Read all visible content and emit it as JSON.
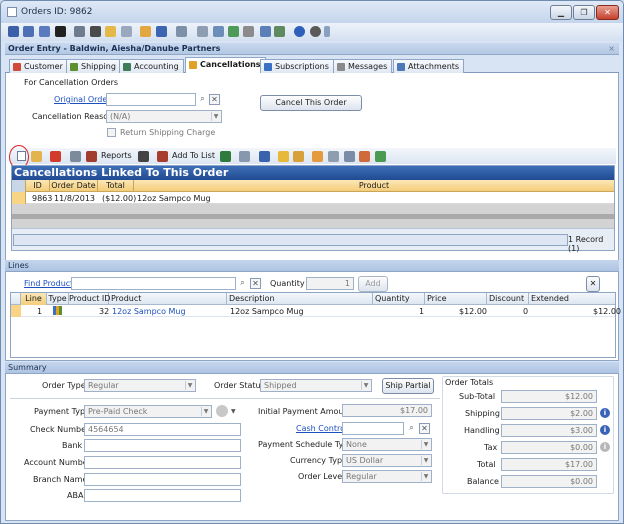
{
  "window": {
    "title": "Orders ID: 9862",
    "minimize": "▁",
    "restore": "❐",
    "close": "✕"
  },
  "order_entry": {
    "title": "Order Entry - Baldwin, Aiesha/Danube Partners",
    "close": "×"
  },
  "tabs": [
    {
      "label": "Customer",
      "color": "#d24a3a"
    },
    {
      "label": "Shipping",
      "color": "#5c8f2e"
    },
    {
      "label": "Accounting",
      "color": "#3e7c5b"
    },
    {
      "label": "Cancellations",
      "color": "#e0a126"
    },
    {
      "label": "Subscriptions",
      "color": "#3a6fc4"
    },
    {
      "label": "Messages",
      "color": "#8a8a8a"
    },
    {
      "label": "Attachments",
      "color": "#4a78b8"
    }
  ],
  "cancellation": {
    "group_title": "For Cancellation Orders",
    "original_order_label": "Original Order",
    "original_order_value": "",
    "reason_label": "Cancellation Reason",
    "reason_value": "(N/A)",
    "return_shipping_label": "Return Shipping Charge",
    "cancel_button": "Cancel This Order"
  },
  "cancel_toolbar": {
    "reports": "Reports",
    "add_to_list": "Add To List"
  },
  "linked": {
    "title": "Cancellations Linked To This Order",
    "columns": [
      "ID",
      "Order Date",
      "Total",
      "Product"
    ],
    "rows": [
      {
        "id": "9863",
        "date": "11/8/2013",
        "total": "($12.00)",
        "product": "12oz Sampco Mug"
      }
    ],
    "record_count": "1 Record (1)"
  },
  "lines": {
    "section": "Lines",
    "find_product_label": "Find Product",
    "find_product_value": "",
    "quantity_label": "Quantity",
    "quantity_value": "1",
    "add_button": "Add",
    "clear_button": "✕",
    "columns": [
      "Line",
      "Type",
      "Product ID",
      "Product",
      "Description",
      "Quantity",
      "Price",
      "Discount",
      "Extended"
    ],
    "rows": [
      {
        "line": "1",
        "product_id": "32",
        "product": "12oz Sampco Mug",
        "description": "12oz Sampco Mug",
        "quantity": "1",
        "price": "$12.00",
        "discount": "0",
        "extended": "$12.00"
      }
    ]
  },
  "summary": {
    "section": "Summary",
    "order_type_label": "Order Type",
    "order_type_value": "Regular",
    "order_status_label": "Order Status",
    "order_status_value": "Shipped",
    "ship_partial_button": "Ship Partial",
    "payment_type_label": "Payment Type",
    "payment_type_value": "Pre-Paid Check",
    "check_number_label": "Check Number",
    "check_number_value": "4564654",
    "bank_label": "Bank",
    "bank_value": "",
    "account_number_label": "Account Number",
    "account_number_value": "",
    "branch_name_label": "Branch Name",
    "branch_name_value": "",
    "aba_label": "ABA",
    "aba_value": "",
    "initial_payment_label": "Initial Payment Amount",
    "initial_payment_value": "$17.00",
    "cash_control_label": "Cash Control",
    "cash_control_value": "",
    "payment_schedule_label": "Payment Schedule Type",
    "payment_schedule_value": "None",
    "currency_label": "Currency Type",
    "currency_value": "US Dollar",
    "order_level_label": "Order Level",
    "order_level_value": "Regular"
  },
  "totals": {
    "title": "Order Totals",
    "subtotal_label": "Sub-Total",
    "subtotal": "$12.00",
    "shipping_label": "Shipping",
    "shipping": "$2.00",
    "handling_label": "Handling",
    "handling": "$3.00",
    "tax_label": "Tax",
    "tax": "$0.00",
    "total_label": "Total",
    "total": "$17.00",
    "balance_label": "Balance",
    "balance": "$0.00"
  },
  "icons": {
    "binoculars": "⌕",
    "clear": "✕",
    "info": "i",
    "dropdown": "▼"
  }
}
